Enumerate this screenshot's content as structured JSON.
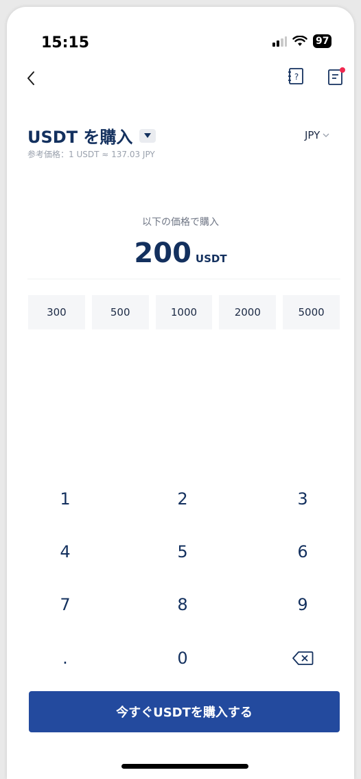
{
  "status_bar": {
    "time": "15:15",
    "battery": "97"
  },
  "header": {
    "title": "USDT を購入",
    "currency": "JPY",
    "reference_price": "参考価格：1 USDT ≈ 137.03 JPY"
  },
  "purchase": {
    "label": "以下の価格で購入",
    "amount": "200",
    "unit": "USDT"
  },
  "presets": [
    "300",
    "500",
    "1000",
    "2000",
    "5000"
  ],
  "keypad": {
    "k1": "1",
    "k2": "2",
    "k3": "3",
    "k4": "4",
    "k5": "5",
    "k6": "6",
    "k7": "7",
    "k8": "8",
    "k9": "9",
    "dot": ".",
    "k0": "0"
  },
  "cta": {
    "label": "今すぐUSDTを購入する"
  },
  "colors": {
    "primary": "#234a9e",
    "title": "#13305e",
    "badge": "#f0284f"
  }
}
